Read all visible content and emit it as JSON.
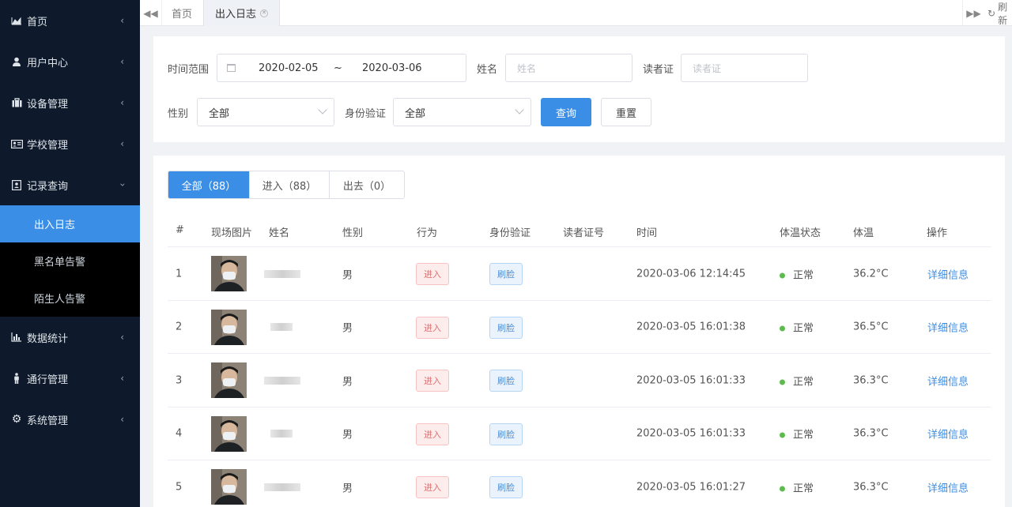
{
  "colors": {
    "sidebar_bg": "#0e1a2b",
    "accent": "#3a8ee6",
    "status_ok": "#5dbb4e",
    "tag_in": "#e06c6c",
    "tag_face": "#4a90d9"
  },
  "sidebar": {
    "items": [
      {
        "label": "首页",
        "icon": "chart-area-icon"
      },
      {
        "label": "用户中心",
        "icon": "user-icon"
      },
      {
        "label": "设备管理",
        "icon": "briefcase-icon"
      },
      {
        "label": "学校管理",
        "icon": "id-card-icon"
      },
      {
        "label": "记录查询",
        "icon": "contact-book-icon"
      }
    ],
    "subitems": [
      "出入日志",
      "黑名单告警",
      "陌生人告警"
    ],
    "items2": [
      {
        "label": "数据统计",
        "icon": "bar-chart-icon"
      },
      {
        "label": "通行管理",
        "icon": "person-icon"
      },
      {
        "label": "系统管理",
        "icon": "gear-icon"
      }
    ]
  },
  "tabs": {
    "home": "首页",
    "current": "出入日志",
    "refresh": "刷新"
  },
  "filter": {
    "time_label": "时间范围",
    "date_start": "2020-02-05",
    "date_sep": "~",
    "date_end": "2020-03-06",
    "name_label": "姓名",
    "name_placeholder": "姓名",
    "card_label": "读者证",
    "card_placeholder": "读者证",
    "gender_label": "性别",
    "gender_value": "全部",
    "verify_label": "身份验证",
    "verify_value": "全部",
    "query_button": "查询",
    "reset_button": "重置"
  },
  "segments": [
    "全部（88）",
    "进入（88）",
    "出去（0）"
  ],
  "table": {
    "headers": [
      "#",
      "现场图片",
      "姓名",
      "性别",
      "行为",
      "身份验证",
      "读者证号",
      "时间",
      "体温状态",
      "体温",
      "操作"
    ],
    "rows": [
      {
        "no": "1",
        "gender": "男",
        "action": "进入",
        "verify": "刷脸",
        "time": "2020-03-06 12:14:45",
        "status": "正常",
        "temp": "36.2°C",
        "op": "详细信息"
      },
      {
        "no": "2",
        "gender": "男",
        "action": "进入",
        "verify": "刷脸",
        "time": "2020-03-05 16:01:38",
        "status": "正常",
        "temp": "36.5°C",
        "op": "详细信息"
      },
      {
        "no": "3",
        "gender": "男",
        "action": "进入",
        "verify": "刷脸",
        "time": "2020-03-05 16:01:33",
        "status": "正常",
        "temp": "36.3°C",
        "op": "详细信息"
      },
      {
        "no": "4",
        "gender": "男",
        "action": "进入",
        "verify": "刷脸",
        "time": "2020-03-05 16:01:33",
        "status": "正常",
        "temp": "36.3°C",
        "op": "详细信息"
      },
      {
        "no": "5",
        "gender": "男",
        "action": "进入",
        "verify": "刷脸",
        "time": "2020-03-05 16:01:27",
        "status": "正常",
        "temp": "36.3°C",
        "op": "详细信息"
      }
    ]
  }
}
